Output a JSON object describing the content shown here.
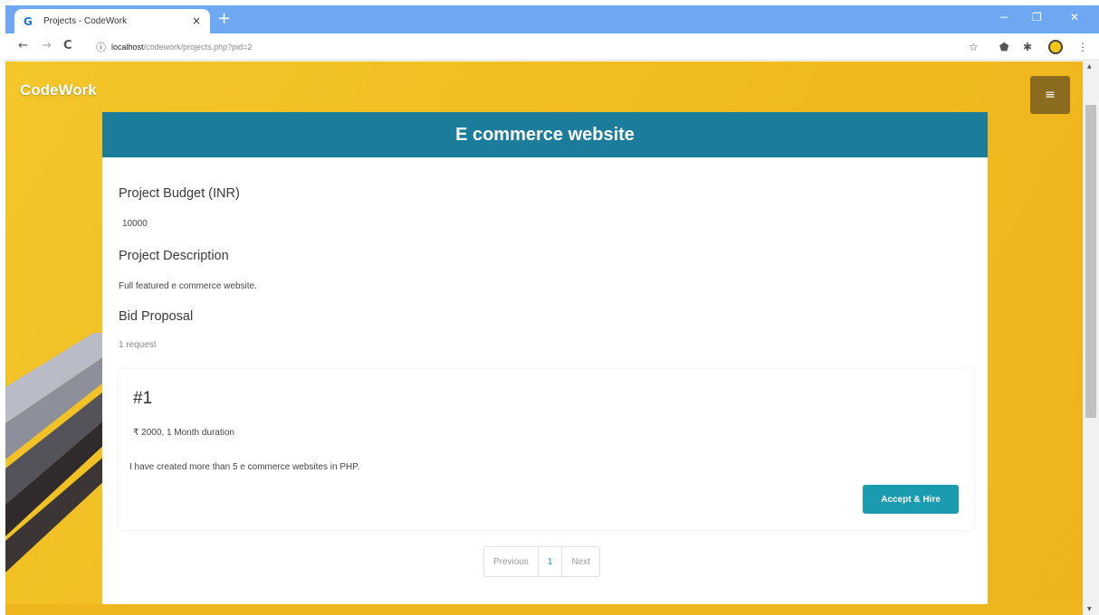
{
  "browser": {
    "tab_title": "Projects - CodeWork",
    "tab_favicon": "G",
    "tab_close": "×",
    "new_tab": "+",
    "minimize": "−",
    "maximize": "❐",
    "close": "✕",
    "back": "←",
    "forward": "→",
    "reload": "C",
    "info": "ⓘ",
    "url_host": "localhost",
    "url_path": "/codework/projects.php?pid=2",
    "star": "☆",
    "extension1": "⬟",
    "extension2": "✱",
    "menu": "⋮"
  },
  "nav": {
    "brand": "CodeWork",
    "menu_icon": "≡"
  },
  "project": {
    "title": "E commerce website",
    "budget_label": "Project Budget (INR)",
    "budget_value": "10000",
    "description_label": "Project Description",
    "description_value": "Full featured e commerce website.",
    "bid_label": "Bid Proposal",
    "bid_count": "1 request"
  },
  "bids": [
    {
      "number": "#1",
      "meta": "₹ 2000, 1 Month duration",
      "text": "I have created more than 5 e commerce websites in PHP.",
      "action": "Accept & Hire"
    }
  ],
  "pagination": {
    "previous": "Previous",
    "page": "1",
    "next": "Next"
  },
  "scroll": {
    "up": "▲",
    "down": "▼"
  }
}
